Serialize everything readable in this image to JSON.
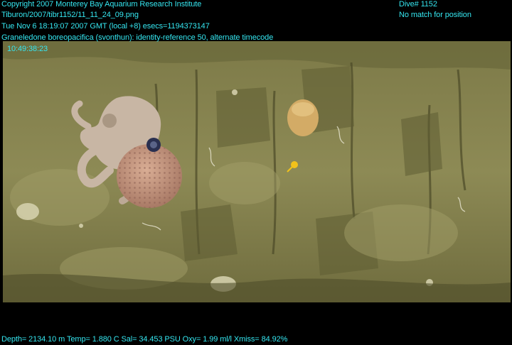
{
  "overlay": {
    "copyright": "Copyright 2007 Monterey Bay Aquarium Research Institute",
    "file_path": "Tiburon/2007/tibr1152/11_11_24_09.png",
    "datetime": "Tue Nov  6 18:19:07 2007 GMT (local +8)  esecs=1194373147",
    "annotation": "Graneledone boreopacifica (svonthun): identity-reference 50, alternate timecode",
    "timecode": "10:49:38:23",
    "dive": "Dive# 1152",
    "position": "No match for position",
    "telemetry": "Depth= 2134.10 m  Temp= 1.880 C  Sal= 34.453 PSU  Oxy= 1.99 ml/l  Xmiss= 84.92%"
  },
  "colors": {
    "overlay_text": "#35e6f0",
    "background": "#000000",
    "sediment": "#8b8752",
    "octopus": "#c8b6a4",
    "sea_cucumber": "#c99980",
    "yellow_organism": "#f2c21a"
  }
}
